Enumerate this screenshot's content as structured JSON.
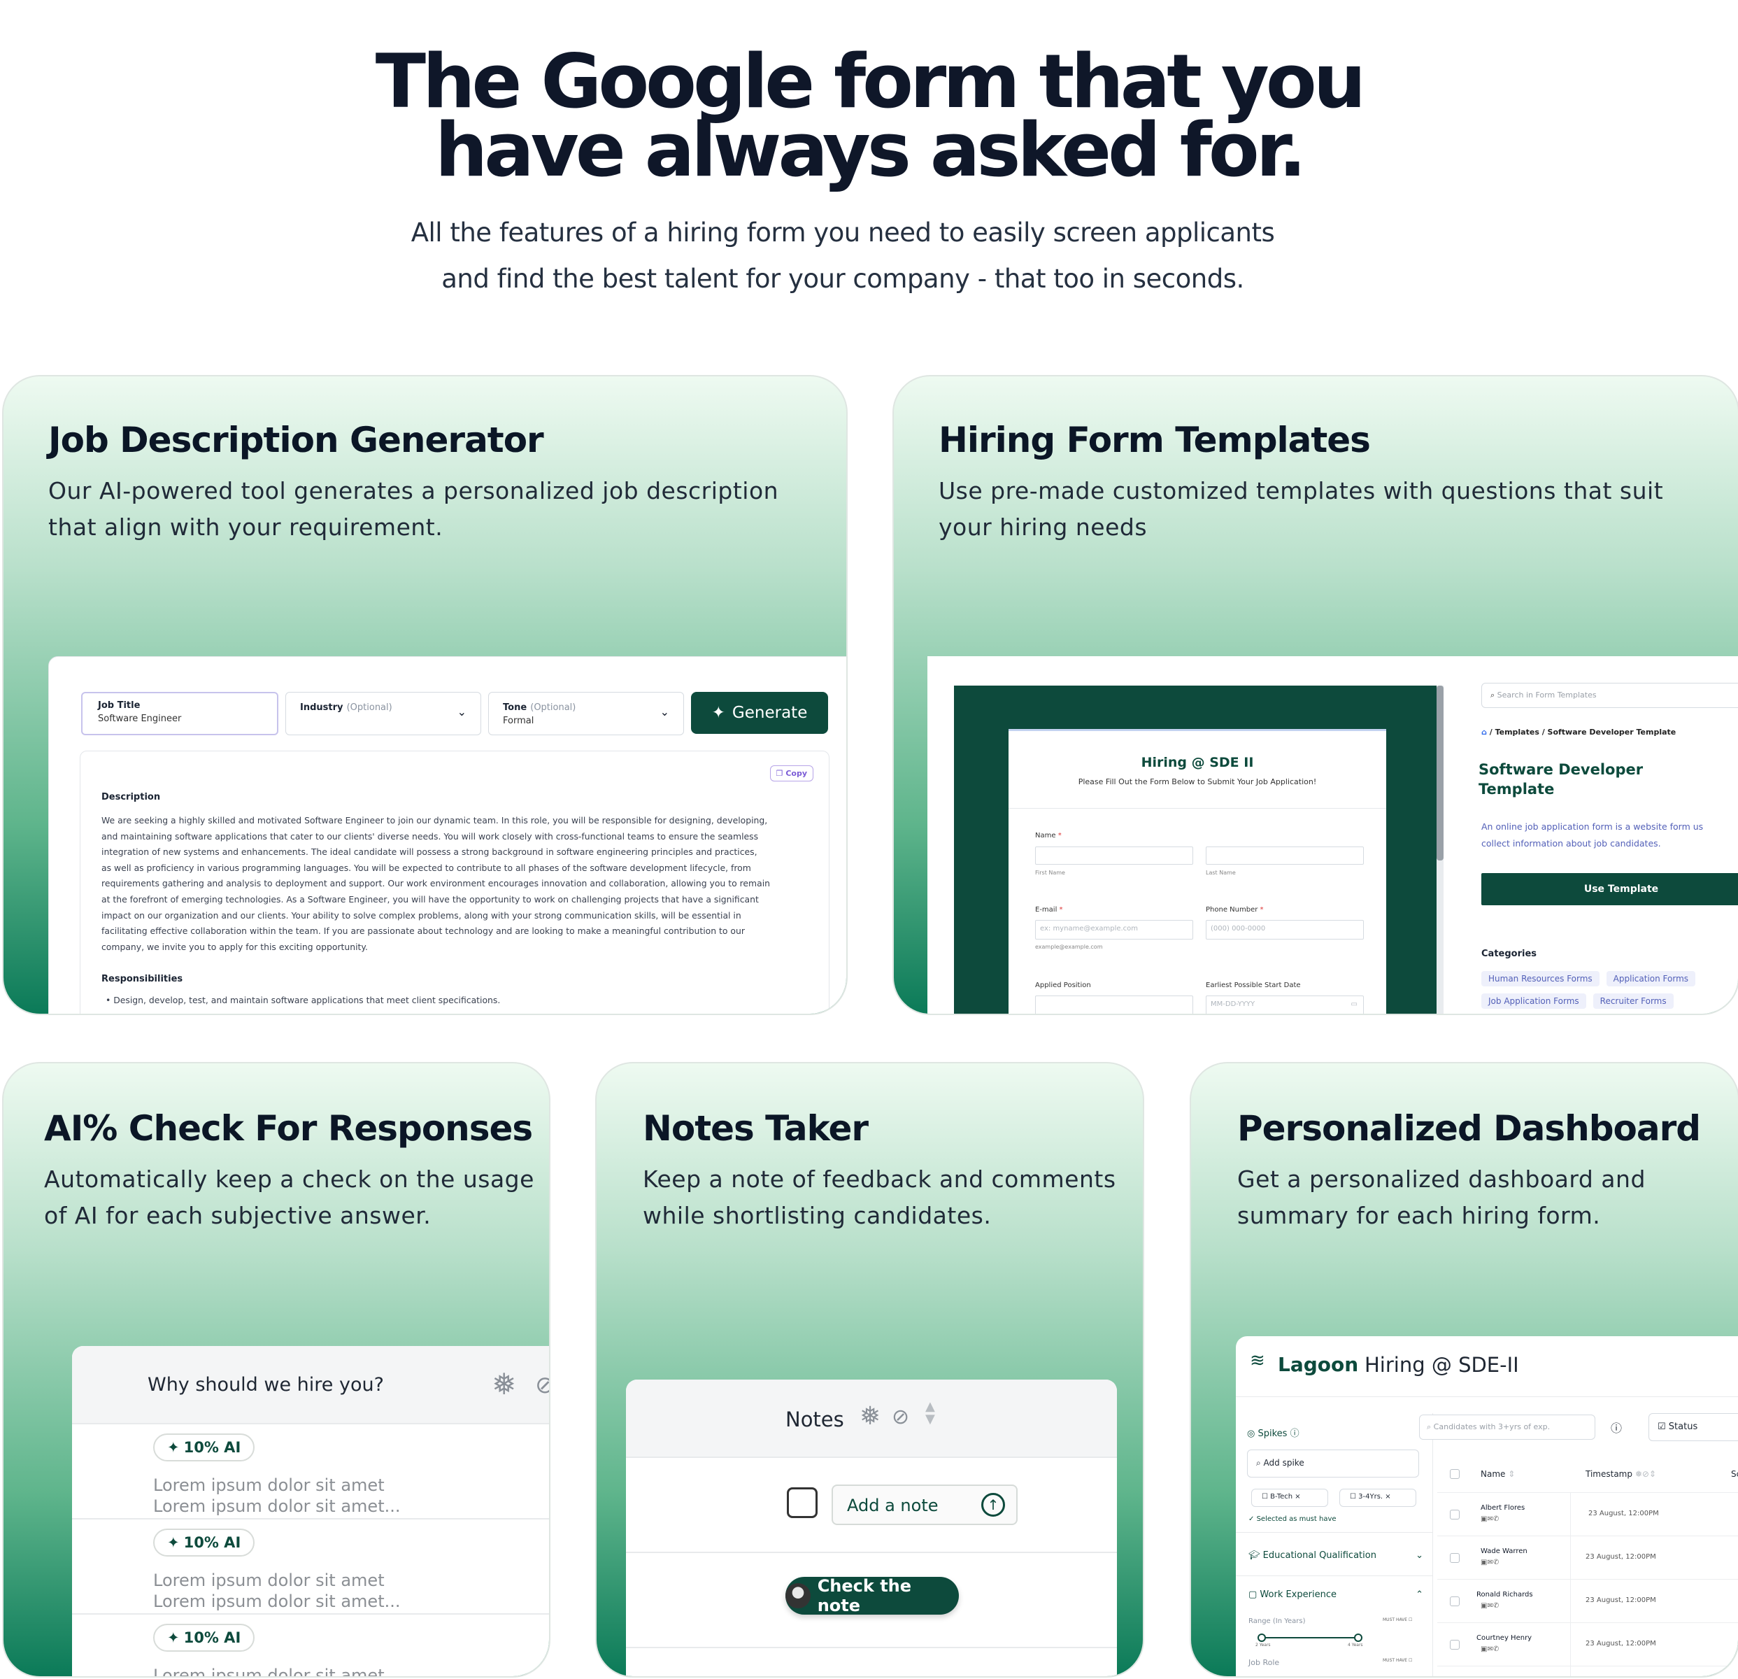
{
  "hero": {
    "title_line1": "The Google form that you",
    "title_line2": "have always asked for.",
    "subtitle_line1": "All the features of a hiring form you need to easily screen applicants",
    "subtitle_line2": "and find the best talent for your company - that too in seconds."
  },
  "colors": {
    "brand_dark": "#0d4a3c",
    "accent_green": "#0b7a58",
    "gradient_top": "#eefaf1"
  },
  "jd": {
    "title": "Job Description Generator",
    "desc_line1": "Our AI-powered tool generates a personalized job description",
    "desc_line2": "that align with your requirement.",
    "job_title_label": "Job Title",
    "job_title_value": "Software Engineer",
    "industry_label": "Industry",
    "industry_optional": "(Optional)",
    "tone_label": "Tone",
    "tone_optional": "(Optional)",
    "tone_value": "Formal",
    "generate_label": "Generate",
    "copy_label": "Copy",
    "description_heading": "Description",
    "description_lines": [
      "We are seeking a highly skilled and motivated Software Engineer to join our dynamic team. In this role, you will be responsible for designing, developing,",
      "and maintaining software applications that cater to our clients' diverse needs. You will work closely with cross-functional teams to ensure the seamless",
      "integration of new systems and enhancements. The ideal candidate will possess a strong background in software engineering principles and practices,",
      "as well as proficiency in various programming languages. You will be expected to contribute to all phases of the software development lifecycle, from",
      "requirements gathering and analysis to deployment and support. Our work environment encourages innovation and collaboration, allowing you to remain",
      "at the forefront of emerging technologies. As a Software Engineer, you will have the opportunity to work on challenging projects that have a significant",
      "impact on our organization and our clients. Your ability to solve complex problems, along with your strong communication skills, will be essential in",
      "facilitating effective collaboration within the team. If you are passionate about technology and are looking to make a meaningful contribution to our",
      "company, we invite you to apply for this exciting opportunity."
    ],
    "responsibilities_heading": "Responsibilities",
    "responsibility_1": "Design, develop, test, and maintain software applications that meet client specifications."
  },
  "templates": {
    "title": "Hiring Form Templates",
    "desc_line1": "Use pre-made customized templates with questions that suit",
    "desc_line2": "your hiring needs",
    "form_title": "Hiring @ SDE II",
    "form_subtitle": "Please Fill Out the Form Below to Submit Your Job Application!",
    "name_label": "Name",
    "first_name": "First Name",
    "last_name": "Last Name",
    "email_label": "E-mail",
    "email_placeholder": "ex: myname@example.com",
    "email_hint": "example@example.com",
    "phone_label": "Phone Number",
    "phone_placeholder": "(000) 000-0000",
    "position_label": "Applied Position",
    "start_label": "Earliest Possible Start Date",
    "date_placeholder": "MM-DD-YYYY",
    "search_placeholder": "Search in Form Templates",
    "breadcrumb": "Templates / Software Developer Template",
    "template_title_line1": "Software Developer",
    "template_title_line2": "Template",
    "template_desc_line1": "An online job application form is a website form us",
    "template_desc_line2": "collect information about job candidates.",
    "use_template": "Use Template",
    "categories_label": "Categories",
    "categories": [
      "Human Resources Forms",
      "Application Forms",
      "Job Application Forms",
      "Recruiter Forms"
    ]
  },
  "ai_check": {
    "title": "AI% Check For Responses",
    "desc_line1": "Automatically keep a check on the usage",
    "desc_line2": "of AI for each subjective answer.",
    "question": "Why should we hire you?",
    "pill": "10% AI",
    "lorem_line1": "Lorem ipsum dolor sit amet",
    "lorem_line2": "Lorem ipsum dolor sit amet..."
  },
  "notes": {
    "title": "Notes Taker",
    "desc_line1": "Keep a note of feedback and comments",
    "desc_line2": "while shortlisting candidates.",
    "panel_title": "Notes",
    "add_note": "Add a note",
    "check_note": "Check the note"
  },
  "dashboard": {
    "title": "Personalized Dashboard",
    "desc_line1": "Get a personalized dashboard and",
    "desc_line2": "summary for each hiring form.",
    "brand": "Lagoon",
    "form_name": "Hiring @ SDE-II",
    "spikes_label": "Spikes",
    "search_placeholder": "Candidates with 3+yrs of exp.",
    "status_label": "Status",
    "add_spike": "Add spike",
    "tag_1": "B-Tech",
    "tag_2": "3-4Yrs.",
    "must_have_note": "Selected as must have",
    "edu_label": "Educational Qualification",
    "work_label": "Work Experience",
    "range_label": "Range (In Years)",
    "must_have": "MUST HAVE",
    "slider_min": "2 Years",
    "slider_max": "4 Years",
    "job_role": "Job Role",
    "col_name": "Name",
    "col_timestamp": "Timestamp",
    "col_extra": "Sc",
    "rows": [
      {
        "name": "Albert Flores",
        "timestamp": "23 August, 12:00PM"
      },
      {
        "name": "Wade Warren",
        "timestamp": "23 August, 12:00PM"
      },
      {
        "name": "Ronald Richards",
        "timestamp": "23 August, 12:00PM"
      },
      {
        "name": "Courtney Henry",
        "timestamp": "23 August, 12:00PM"
      }
    ]
  }
}
